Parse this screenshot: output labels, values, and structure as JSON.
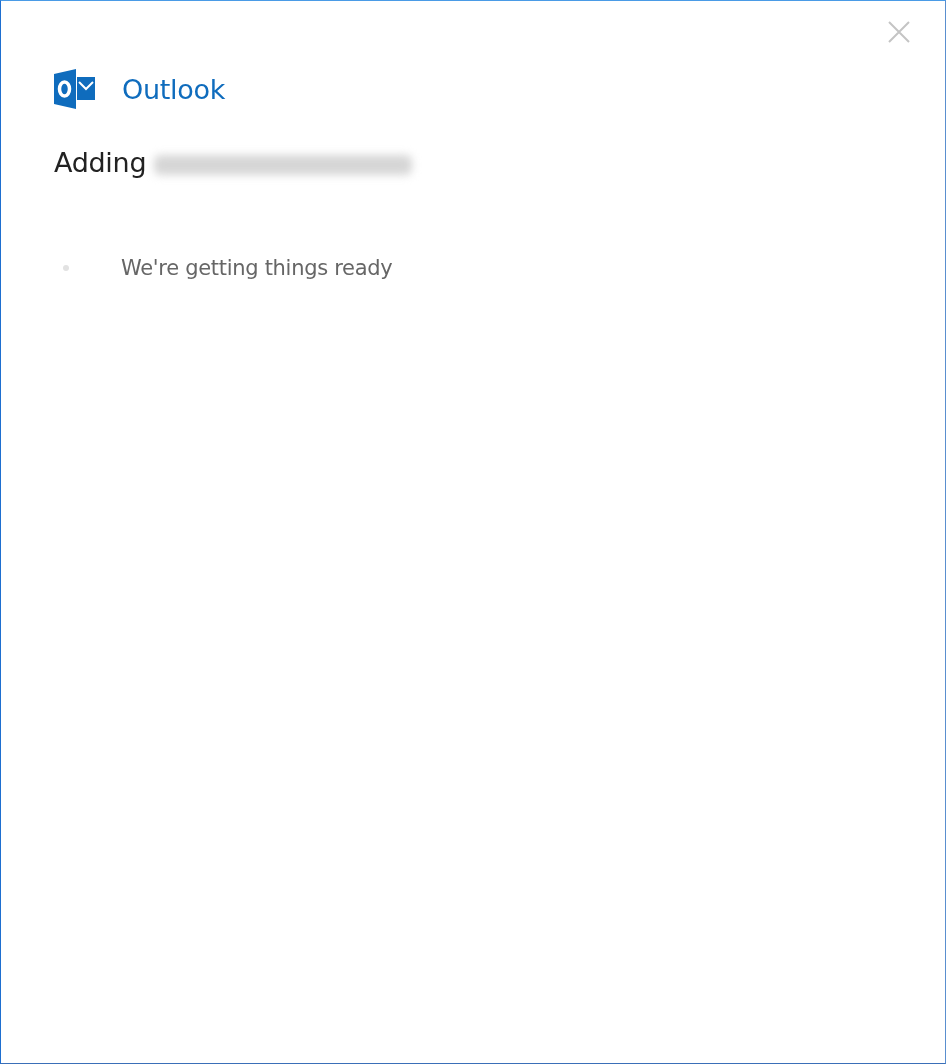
{
  "app": {
    "name": "Outlook"
  },
  "heading": {
    "text": "Adding",
    "email_redacted": true
  },
  "progress": {
    "message": "We're getting things ready"
  }
}
